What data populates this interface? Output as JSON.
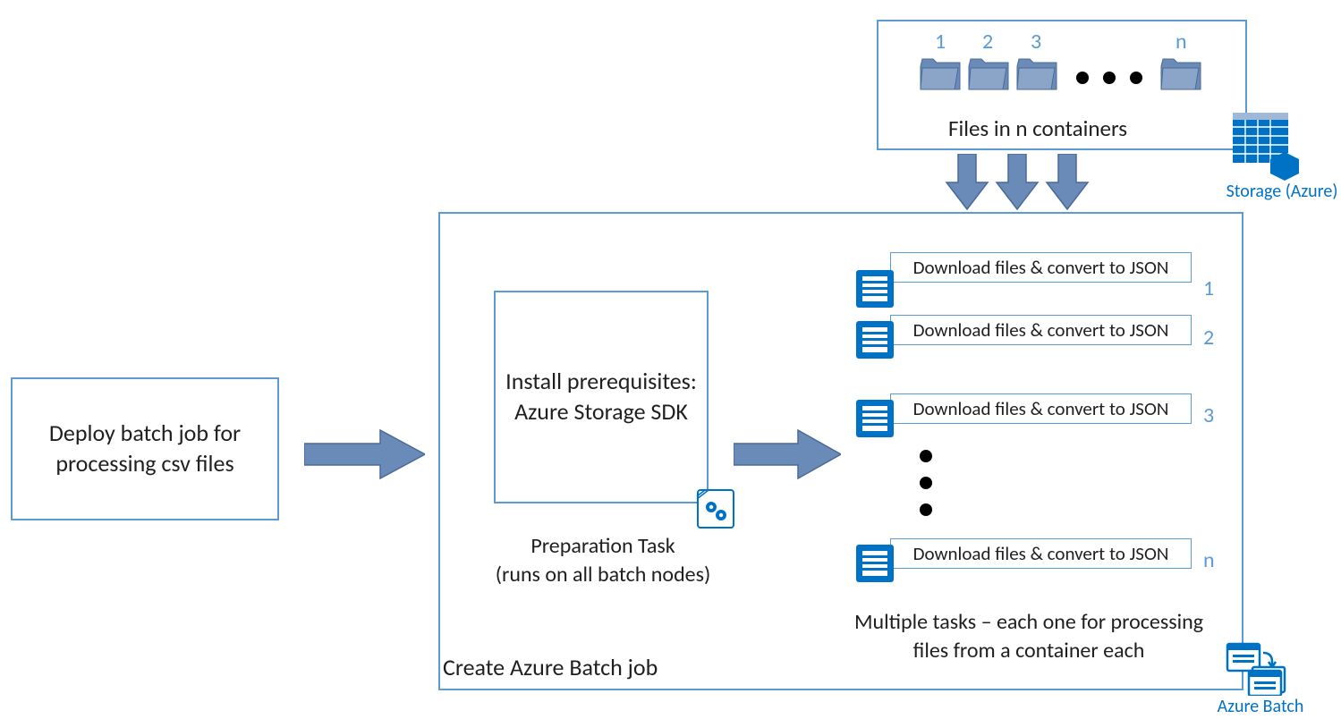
{
  "deploy": {
    "text": "Deploy batch job for processing csv files"
  },
  "batch_job": {
    "label": "Create Azure Batch job"
  },
  "install": {
    "text": "Install prerequisites: Azure Storage SDK",
    "caption": "Preparation Task\n(runs on all batch nodes)"
  },
  "containers": {
    "label": "Files in n containers",
    "numbers": [
      "1",
      "2",
      "3",
      "n"
    ]
  },
  "tasks": {
    "row_text": "Download files & convert to JSON",
    "numbers": [
      "1",
      "2",
      "3",
      "n"
    ],
    "caption": "Multiple tasks – each one for processing files from a container each"
  },
  "services": {
    "storage": "Storage (Azure)",
    "batch": "Azure Batch"
  }
}
